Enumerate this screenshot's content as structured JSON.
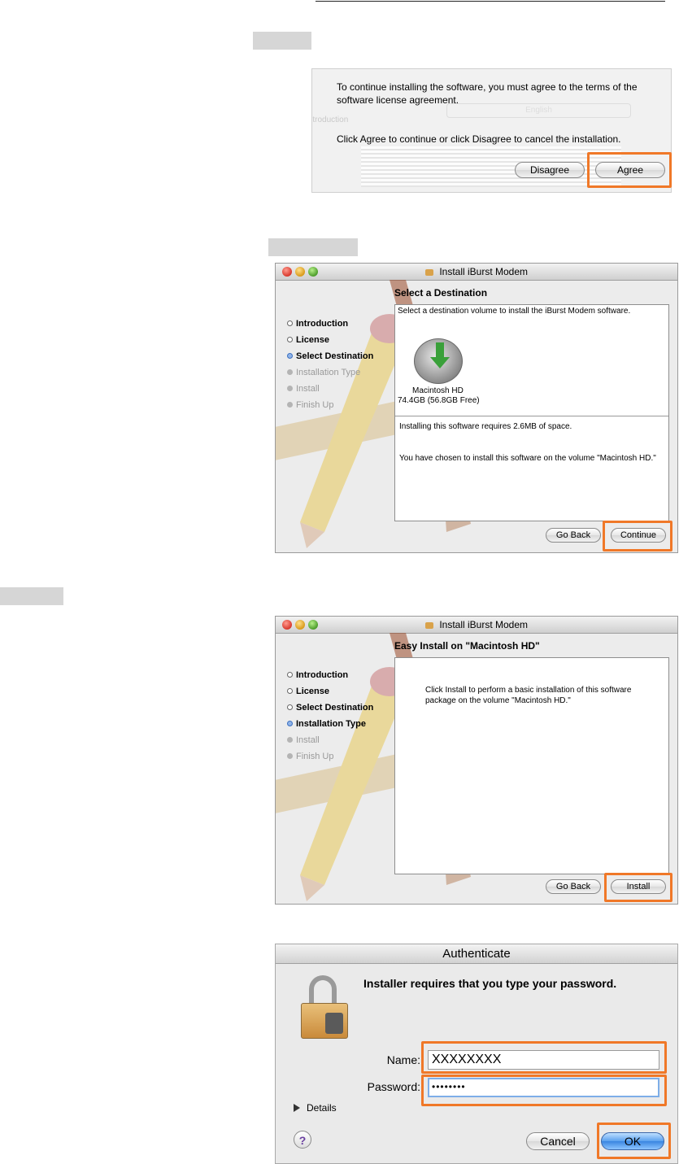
{
  "section1": {
    "dialog": {
      "message1": "To continue installing the software, you must agree to the terms of the software license agreement.",
      "message2": "Click Agree to continue or click Disagree to cancel the installation.",
      "disagree_label": "Disagree",
      "agree_label": "Agree"
    },
    "background": {
      "step_introduction": "Introduction",
      "language": "English"
    }
  },
  "section2": {
    "window_title": "Install iBurst Modem",
    "heading": "Select a Destination",
    "steps": [
      "Introduction",
      "License",
      "Select Destination",
      "Installation Type",
      "Install",
      "Finish Up"
    ],
    "prompt": "Select a destination volume to install the iBurst Modem software.",
    "volume_name": "Macintosh HD",
    "volume_size": "74.4GB (56.8GB Free)",
    "space_required": "Installing this software requires 2.6MB of space.",
    "chosen_volume": "You have chosen to install this software on the volume \"Macintosh HD.\"",
    "back_label": "Go Back",
    "continue_label": "Continue"
  },
  "section3": {
    "window_title": "Install iBurst Modem",
    "heading": "Easy Install on \"Macintosh HD\"",
    "steps": [
      "Introduction",
      "License",
      "Select Destination",
      "Installation Type",
      "Install",
      "Finish Up"
    ],
    "message": "Click Install to perform a basic installation of this software package on the volume \"Macintosh HD.\"",
    "back_label": "Go Back",
    "install_label": "Install"
  },
  "section4": {
    "window_title": "Authenticate",
    "message": "Installer requires that you type your password.",
    "name_label": "Name:",
    "name_value": "XXXXXXXX",
    "password_label": "Password:",
    "password_value": "••••••••",
    "details_label": "Details",
    "help_label": "?",
    "cancel_label": "Cancel",
    "ok_label": "OK"
  },
  "colors": {
    "highlight": "#f07828",
    "label_bar": "#d6d6d6",
    "aqua_blue": "#4f8fe0"
  }
}
